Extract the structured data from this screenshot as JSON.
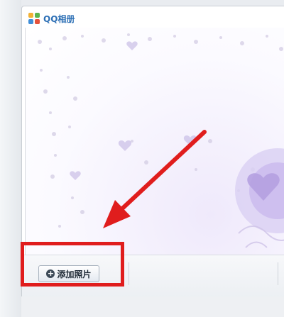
{
  "window": {
    "title": "QQ相册",
    "icon": "qq-album-logo-icon"
  },
  "toolbar": {
    "add_photo_label": "添加照片",
    "add_photo_icon": "plus-circle-icon"
  },
  "annotation": {
    "arrow_color": "#e01d1d",
    "highlight_color": "#e01d1d"
  },
  "theme": {
    "title_color": "#2c6fb5",
    "background_tint": "#efe9fb"
  }
}
